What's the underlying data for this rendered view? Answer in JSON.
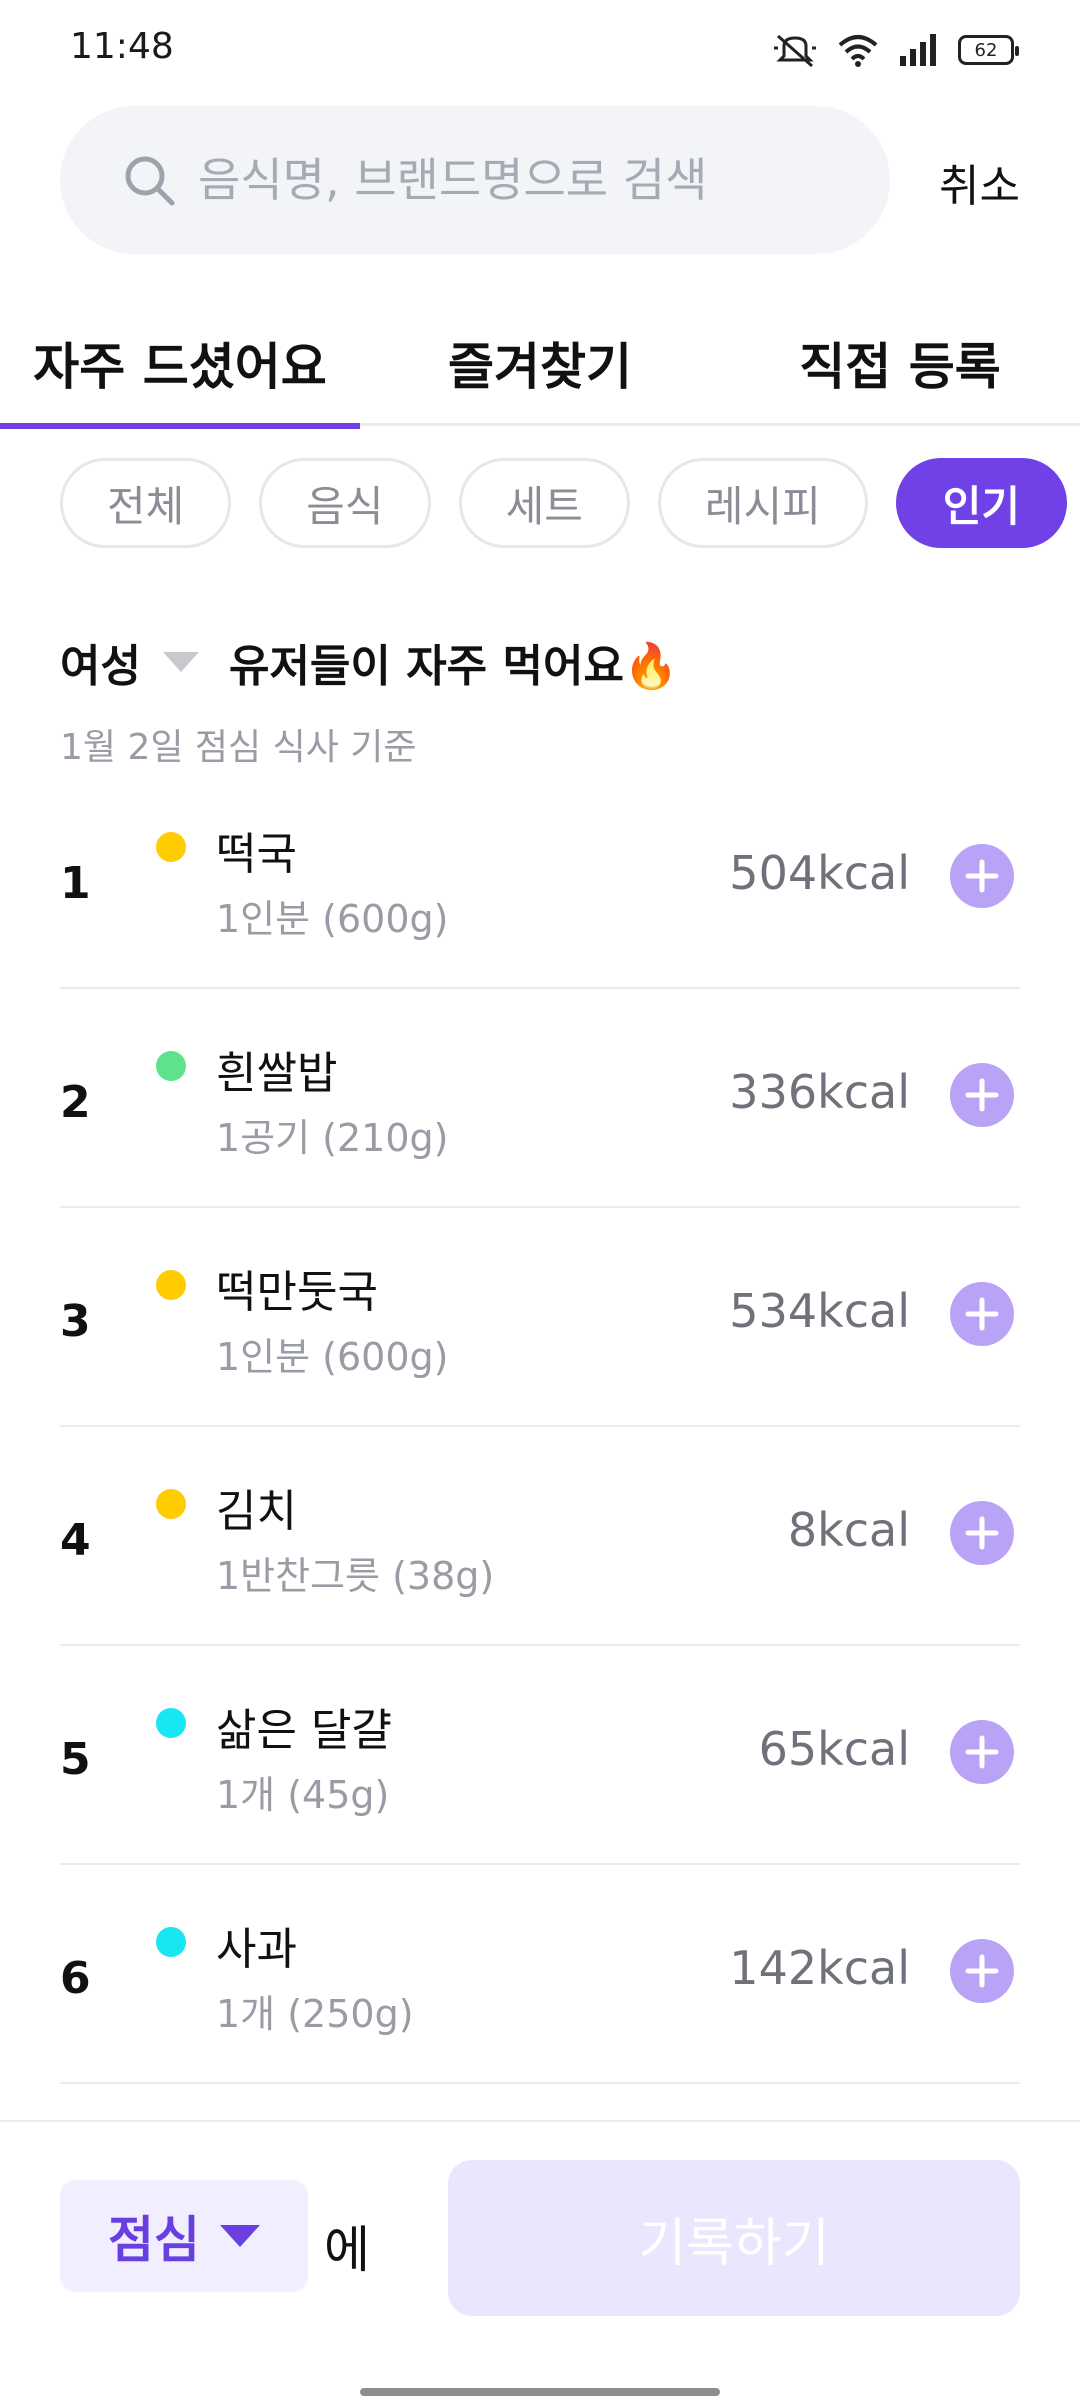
{
  "status_bar": {
    "time": "11:48",
    "battery": "62"
  },
  "search": {
    "placeholder": "음식명, 브랜드명으로 검색",
    "cancel_label": "취소"
  },
  "tabs": [
    {
      "label": "자주 드셨어요",
      "active": true
    },
    {
      "label": "즐겨찾기",
      "active": false
    },
    {
      "label": "직접 등록",
      "active": false
    }
  ],
  "chips": [
    {
      "label": "전체",
      "active": false
    },
    {
      "label": "음식",
      "active": false
    },
    {
      "label": "세트",
      "active": false
    },
    {
      "label": "레시피",
      "active": false
    },
    {
      "label": "인기",
      "active": true
    }
  ],
  "section": {
    "gender": "여성",
    "title": "유저들이 자주 먹어요🔥",
    "subtitle": "1월 2일 점심 식사 기준"
  },
  "foods": [
    {
      "rank": "1",
      "name": "떡국",
      "portion": "1인분 (600g)",
      "kcal": "504kcal",
      "dot_color": "#ffcc00"
    },
    {
      "rank": "2",
      "name": "흰쌀밥",
      "portion": "1공기 (210g)",
      "kcal": "336kcal",
      "dot_color": "#5fe38a"
    },
    {
      "rank": "3",
      "name": "떡만둣국",
      "portion": "1인분 (600g)",
      "kcal": "534kcal",
      "dot_color": "#ffcc00"
    },
    {
      "rank": "4",
      "name": "김치",
      "portion": "1반찬그릇 (38g)",
      "kcal": "8kcal",
      "dot_color": "#ffcc00"
    },
    {
      "rank": "5",
      "name": "삶은 달걀",
      "portion": "1개 (45g)",
      "kcal": "65kcal",
      "dot_color": "#18e6f0"
    },
    {
      "rank": "6",
      "name": "사과",
      "portion": "1개 (250g)",
      "kcal": "142kcal",
      "dot_color": "#18e6f0"
    }
  ],
  "bottom": {
    "meal": "점심",
    "suffix": "에",
    "record_label": "기록하기"
  },
  "colors": {
    "accent": "#7041e6",
    "add_button": "#b9a3f7"
  }
}
